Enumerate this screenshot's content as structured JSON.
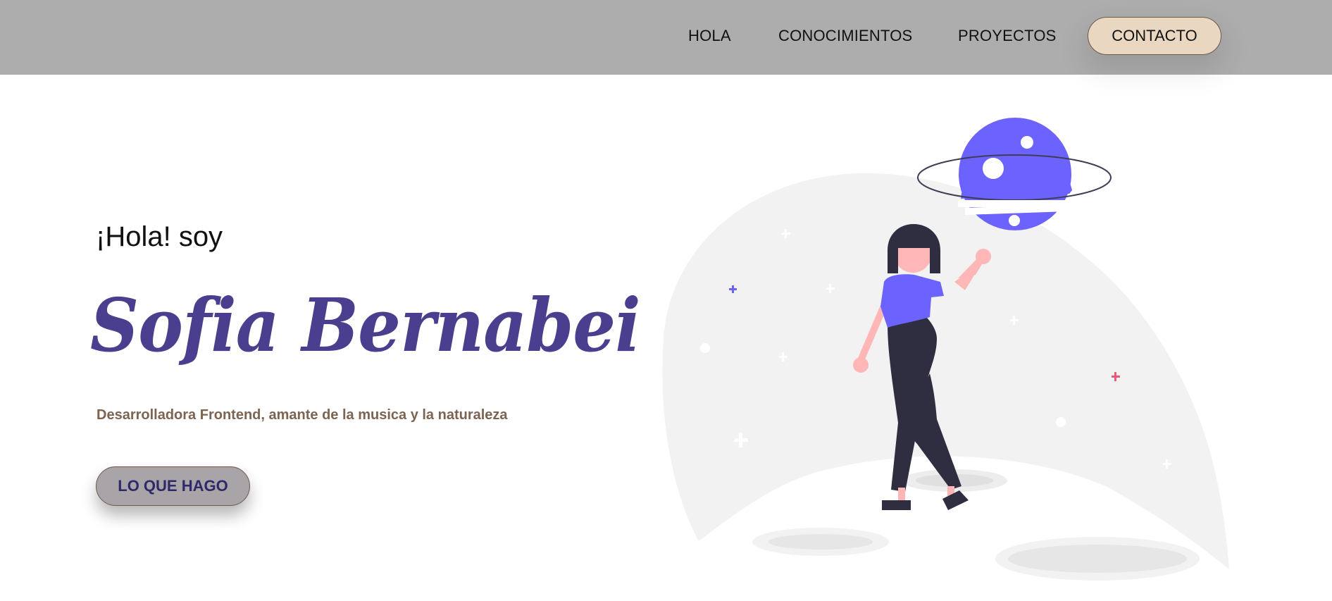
{
  "nav": {
    "items": [
      {
        "label": "HOLA"
      },
      {
        "label": "CONOCIMIENTOS"
      },
      {
        "label": "PROYECTOS"
      }
    ],
    "contact_label": "CONTACTO"
  },
  "hero": {
    "greeting": "¡Hola! soy",
    "name": "Sofia Bernabei",
    "tagline": "Desarrolladora Frontend, amante de la musica y la naturaleza",
    "cta_label": "LO QUE HAGO"
  },
  "colors": {
    "navbar": "#adadad",
    "contact_button": "#ead7c2",
    "name_text": "#4a3f8f",
    "tagline_text": "#7d6451",
    "cta_button": "#a8a4a8",
    "planet": "#6c63ff",
    "shirt": "#6c63ff",
    "skin": "#ffb6b6",
    "dark": "#2f2e41",
    "moon": "#f2f2f2"
  },
  "illustration": {
    "icon": "astronaut-girl-planet-illustration"
  }
}
